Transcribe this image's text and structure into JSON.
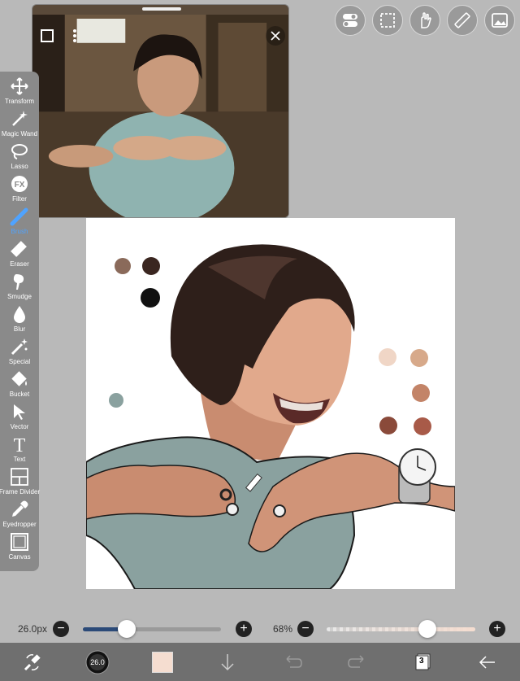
{
  "toolbar_left": {
    "tools": [
      {
        "label": "Transform",
        "icon": "move-icon"
      },
      {
        "label": "Magic Wand",
        "icon": "magic-wand-icon"
      },
      {
        "label": "Lasso",
        "icon": "lasso-icon"
      },
      {
        "label": "Filter",
        "icon": "fx-icon"
      },
      {
        "label": "Brush",
        "icon": "brush-icon",
        "active": true
      },
      {
        "label": "Eraser",
        "icon": "eraser-icon"
      },
      {
        "label": "Smudge",
        "icon": "smudge-icon"
      },
      {
        "label": "Blur",
        "icon": "blur-icon"
      },
      {
        "label": "Special",
        "icon": "special-icon"
      },
      {
        "label": "Bucket",
        "icon": "bucket-icon"
      },
      {
        "label": "Vector",
        "icon": "vector-icon"
      },
      {
        "label": "Text",
        "icon": "text-icon"
      },
      {
        "label": "Frame Divider",
        "icon": "frame-divider-icon"
      },
      {
        "label": "Eyedropper",
        "icon": "eyedropper-icon"
      },
      {
        "label": "Canvas",
        "icon": "canvas-icon"
      }
    ]
  },
  "brush": {
    "size_label": "26.0px",
    "size_fraction": 0.32,
    "opacity_label": "68%",
    "opacity_fraction": 0.68,
    "badge": "26.0"
  },
  "layers": {
    "count": "3"
  },
  "colors": {
    "accent": "#4fa3ff",
    "current_color": "#f5ddd0"
  }
}
